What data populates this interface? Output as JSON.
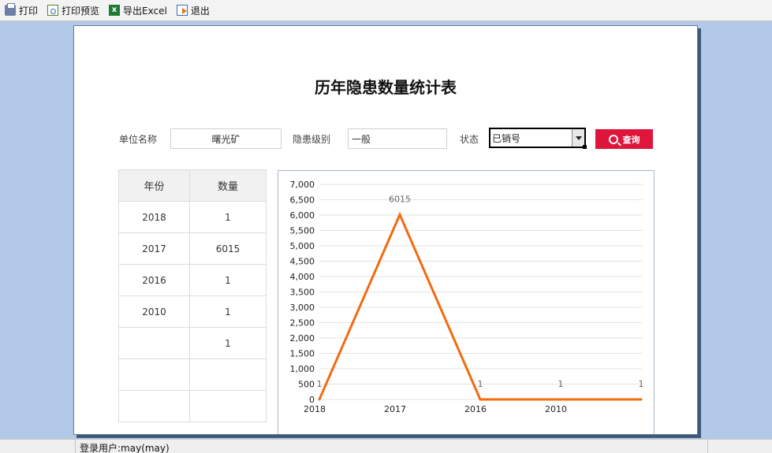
{
  "toolbar": {
    "print": "打印",
    "print_preview": "打印预览",
    "export_excel": "导出Excel",
    "exit": "退出"
  },
  "report": {
    "title": "历年隐患数量统计表"
  },
  "filters": {
    "unit_label": "单位名称",
    "unit_value": "曙光矿",
    "level_label": "隐患级别",
    "level_value": "一般",
    "status_label": "状态",
    "status_value": "已销号",
    "query_button": "查询"
  },
  "table": {
    "headers": [
      "年份",
      "数量"
    ],
    "rows": [
      [
        "2018",
        "1"
      ],
      [
        "2017",
        "6015"
      ],
      [
        "2016",
        "1"
      ],
      [
        "2010",
        "1"
      ],
      [
        "",
        "1"
      ],
      [
        "",
        ""
      ],
      [
        "",
        ""
      ]
    ]
  },
  "chart_data": {
    "type": "line",
    "categories": [
      "2018",
      "2017",
      "2016",
      "2010",
      ""
    ],
    "series": [
      {
        "values": [
          1,
          6015,
          1,
          1,
          1
        ],
        "color": "#f26b0f"
      }
    ],
    "data_labels": [
      "1",
      "6015",
      "1",
      "1",
      "1"
    ],
    "yticks": [
      "0",
      "500",
      "1,000",
      "1,500",
      "2,000",
      "2,500",
      "3,000",
      "3,500",
      "4,000",
      "4,500",
      "5,000",
      "5,500",
      "6,000",
      "6,500",
      "7,000"
    ],
    "ylim": [
      0,
      7000
    ],
    "grid": true,
    "legend": "none"
  },
  "status_bar": {
    "user": "登录用户:may(may)"
  }
}
